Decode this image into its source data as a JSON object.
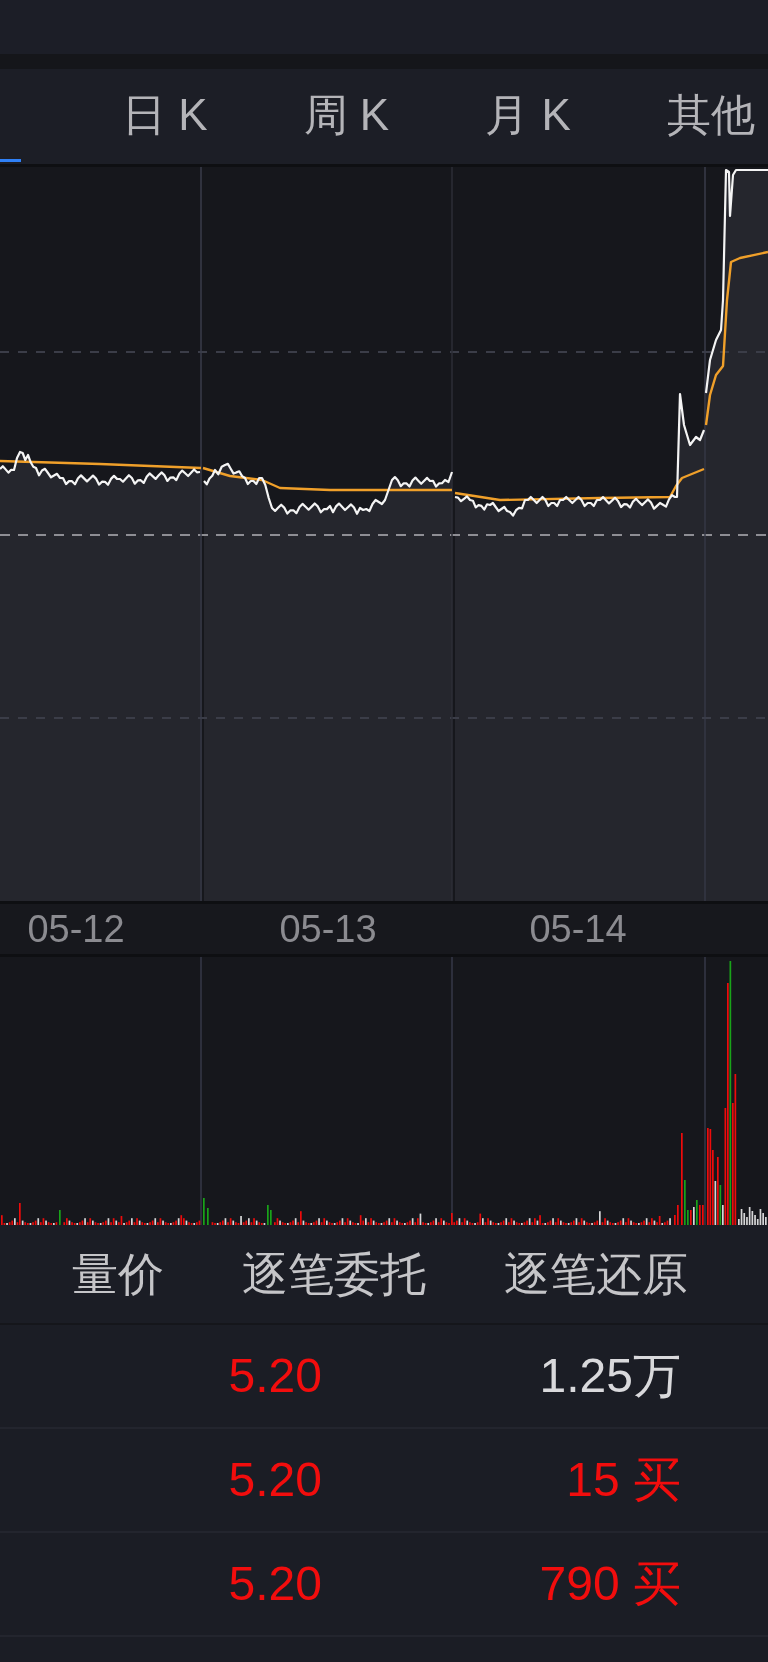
{
  "chart_tabs": [
    {
      "selected": true
    },
    {
      "label": "日 K",
      "selected": false
    },
    {
      "label": "周 K",
      "selected": false
    },
    {
      "label": "月 K",
      "selected": false
    },
    {
      "label": "其他",
      "selected": false
    }
  ],
  "intraday_chart": {
    "dates": [
      "05-12",
      "05-13",
      "05-14"
    ]
  },
  "detail_tabs": [
    {
      "label": "量价"
    },
    {
      "label": "逐笔委托"
    },
    {
      "label": "逐笔还原"
    }
  ],
  "trades": [
    {
      "price": "5.20",
      "rising": true,
      "volume": "1.25万",
      "buy": false
    },
    {
      "price": "5.20",
      "rising": true,
      "volume": "15 买",
      "buy": true
    },
    {
      "price": "5.20",
      "rising": true,
      "volume": "790 买",
      "buy": true
    }
  ]
}
